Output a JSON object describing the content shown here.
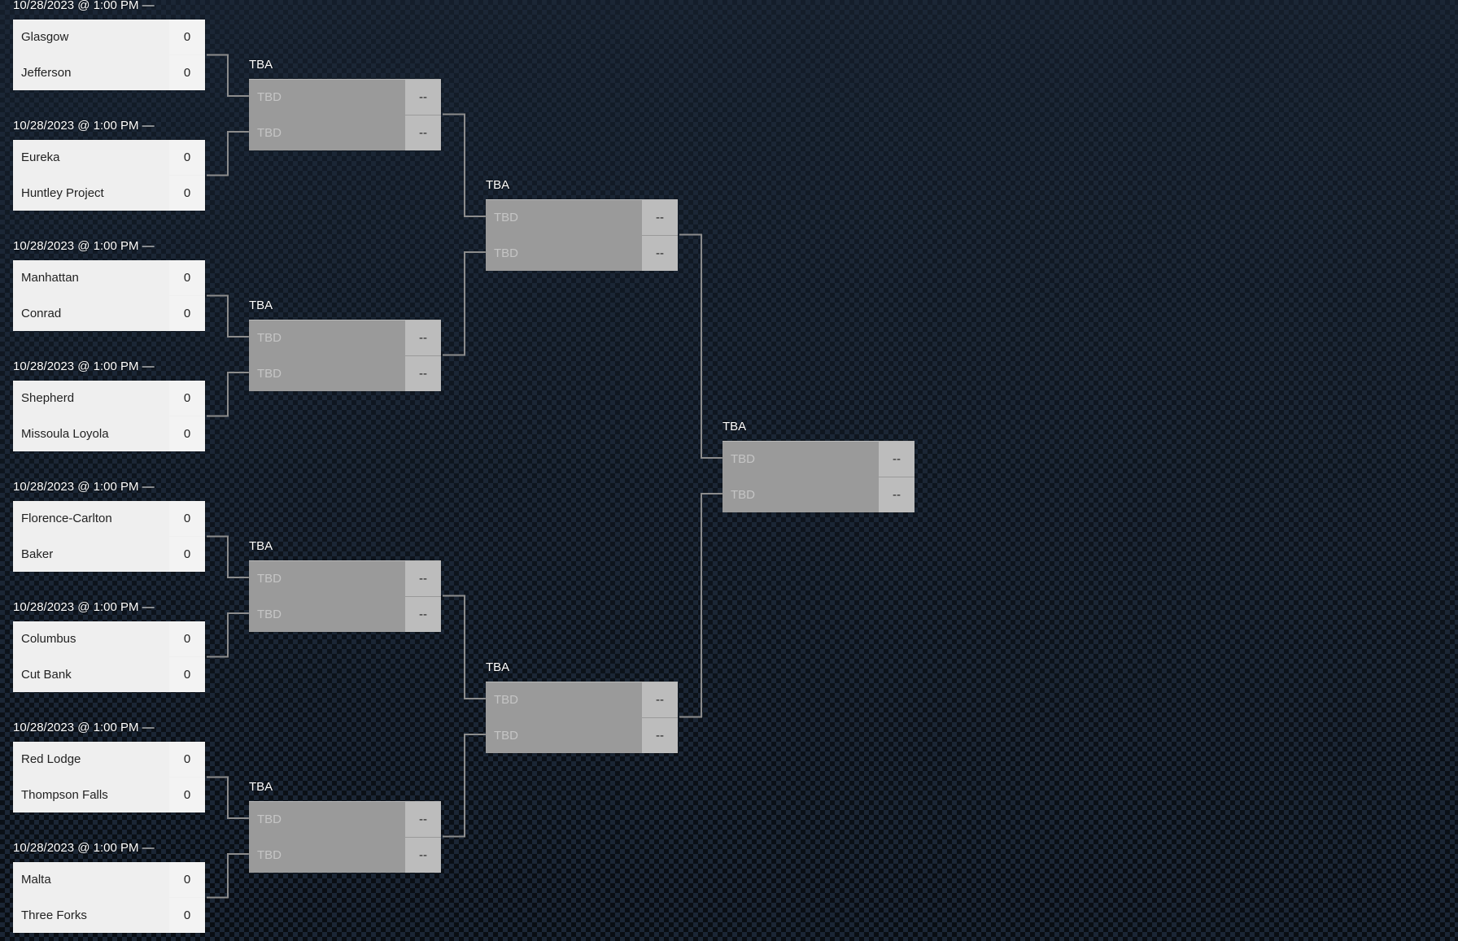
{
  "bracket": {
    "colors": {
      "connector": "#8c8c8c",
      "played_box": "#efefef",
      "tbd_box": "#9a9a9a",
      "tbd_score": "#bcbcbc"
    },
    "rounds": [
      {
        "name": "round-1",
        "matches": [
          {
            "label": "10/28/2023 @ 1:00 PM —",
            "teams": [
              {
                "name": "Glasgow",
                "score": "0"
              },
              {
                "name": "Jefferson",
                "score": "0"
              }
            ]
          },
          {
            "label": "10/28/2023 @ 1:00 PM —",
            "teams": [
              {
                "name": "Eureka",
                "score": "0"
              },
              {
                "name": "Huntley Project",
                "score": "0"
              }
            ]
          },
          {
            "label": "10/28/2023 @ 1:00 PM —",
            "teams": [
              {
                "name": "Manhattan",
                "score": "0"
              },
              {
                "name": "Conrad",
                "score": "0"
              }
            ]
          },
          {
            "label": "10/28/2023 @ 1:00 PM —",
            "teams": [
              {
                "name": "Shepherd",
                "score": "0"
              },
              {
                "name": "Missoula Loyola",
                "score": "0"
              }
            ]
          },
          {
            "label": "10/28/2023 @ 1:00 PM —",
            "teams": [
              {
                "name": "Florence-Carlton",
                "score": "0"
              },
              {
                "name": "Baker",
                "score": "0"
              }
            ]
          },
          {
            "label": "10/28/2023 @ 1:00 PM —",
            "teams": [
              {
                "name": "Columbus",
                "score": "0"
              },
              {
                "name": "Cut Bank",
                "score": "0"
              }
            ]
          },
          {
            "label": "10/28/2023 @ 1:00 PM —",
            "teams": [
              {
                "name": "Red Lodge",
                "score": "0"
              },
              {
                "name": "Thompson Falls",
                "score": "0"
              }
            ]
          },
          {
            "label": "10/28/2023 @ 1:00 PM —",
            "teams": [
              {
                "name": "Malta",
                "score": "0"
              },
              {
                "name": "Three Forks",
                "score": "0"
              }
            ]
          }
        ]
      },
      {
        "name": "round-2",
        "matches": [
          {
            "label": "TBA",
            "teams": [
              {
                "name": "TBD",
                "score": "--"
              },
              {
                "name": "TBD",
                "score": "--"
              }
            ]
          },
          {
            "label": "TBA",
            "teams": [
              {
                "name": "TBD",
                "score": "--"
              },
              {
                "name": "TBD",
                "score": "--"
              }
            ]
          },
          {
            "label": "TBA",
            "teams": [
              {
                "name": "TBD",
                "score": "--"
              },
              {
                "name": "TBD",
                "score": "--"
              }
            ]
          },
          {
            "label": "TBA",
            "teams": [
              {
                "name": "TBD",
                "score": "--"
              },
              {
                "name": "TBD",
                "score": "--"
              }
            ]
          }
        ]
      },
      {
        "name": "semifinals",
        "matches": [
          {
            "label": "TBA",
            "teams": [
              {
                "name": "TBD",
                "score": "--"
              },
              {
                "name": "TBD",
                "score": "--"
              }
            ]
          },
          {
            "label": "TBA",
            "teams": [
              {
                "name": "TBD",
                "score": "--"
              },
              {
                "name": "TBD",
                "score": "--"
              }
            ]
          }
        ]
      },
      {
        "name": "final",
        "matches": [
          {
            "label": "TBA",
            "teams": [
              {
                "name": "TBD",
                "score": "--"
              },
              {
                "name": "TBD",
                "score": "--"
              }
            ]
          }
        ]
      }
    ]
  }
}
